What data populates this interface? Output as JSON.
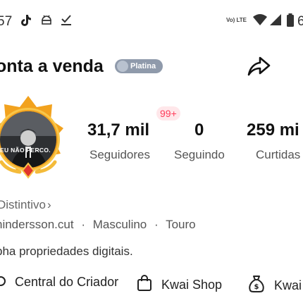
{
  "status_bar": {
    "time": "57",
    "network_label": "Vo) LTE",
    "icons": [
      "tiktok-icon",
      "android-robot-icon",
      "download-check-icon",
      "volte-icon",
      "wifi-icon",
      "signal-icon",
      "battery-icon"
    ]
  },
  "profile": {
    "name": "onta a venda",
    "badge_label": "Platina",
    "avatar_caption": "EU NÃO PERCO.",
    "stats": [
      {
        "value": "31,7 mil",
        "label": "Seguidores"
      },
      {
        "value": "0",
        "label": "Seguindo"
      },
      {
        "value": "259 mi",
        "label": "Curtidas"
      }
    ],
    "notification_count": "99+",
    "distintivo_label": "Distintivo",
    "handle": "hindersson.cut",
    "gender": "Masculino",
    "sign": "Touro",
    "separator": "·",
    "bio": "pha propriedades digitais."
  },
  "links": [
    {
      "label": "Central do Criador",
      "icon": "gear-icon"
    },
    {
      "label": "Kwai Shop",
      "icon": "shopping-bag-icon"
    },
    {
      "label": "Kwai",
      "icon": "money-bag-icon"
    }
  ],
  "colors": {
    "badge": "#8f9aab",
    "notification": "#ff3c5a",
    "avatar_frame": "#f2a21e"
  }
}
